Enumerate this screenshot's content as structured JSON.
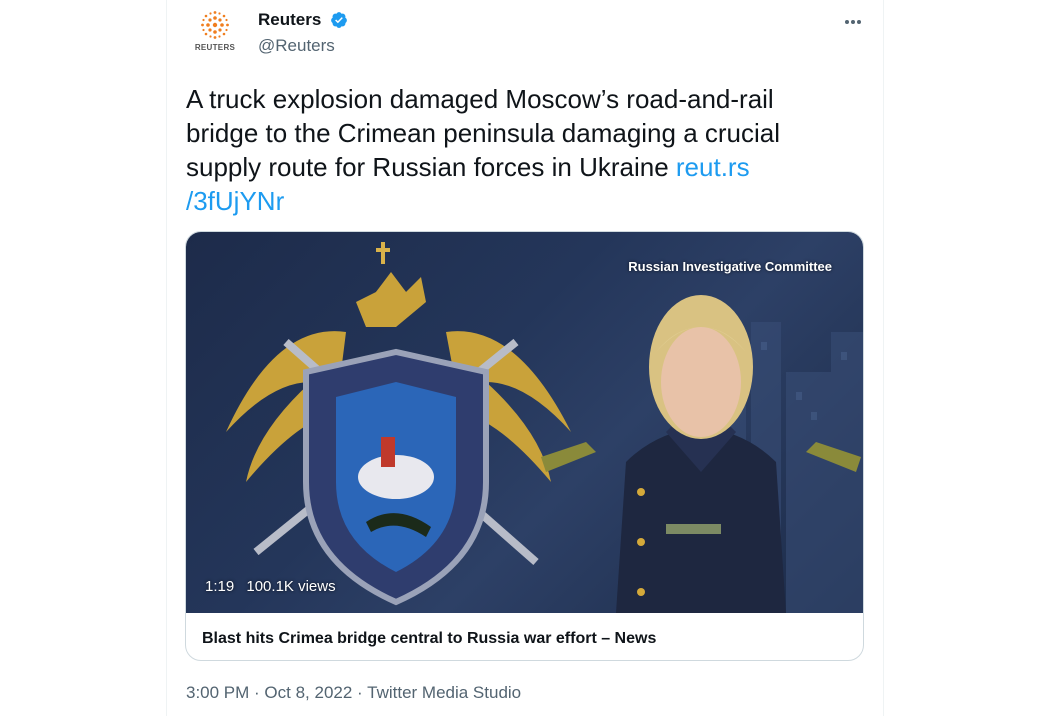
{
  "author": {
    "name": "Reuters",
    "handle": "@Reuters",
    "avatar_text": "REUTERS",
    "verified": true,
    "verified_color": "#1d9bf0"
  },
  "tweet": {
    "text": "A truck explosion damaged Moscow’s road-and-rail bridge to the Crimean peninsula damaging a crucial supply route for Russian forces in Ukraine ",
    "link_text": "reut.rs\n/3fUjYNr"
  },
  "media": {
    "caption": "Russian Investigative Committee",
    "duration": "1:19",
    "views": "100.1K views",
    "link_title": "Blast hits Crimea bridge central to Russia war effort – News"
  },
  "footer": {
    "time": "3:00 PM",
    "separator1": " · ",
    "date": "Oct 8, 2022",
    "separator2": " · ",
    "source": "Twitter Media Studio"
  },
  "colors": {
    "link": "#1d9bf0",
    "text": "#0f1419",
    "secondary": "#536471",
    "reuters_orange": "#f07e1f"
  }
}
